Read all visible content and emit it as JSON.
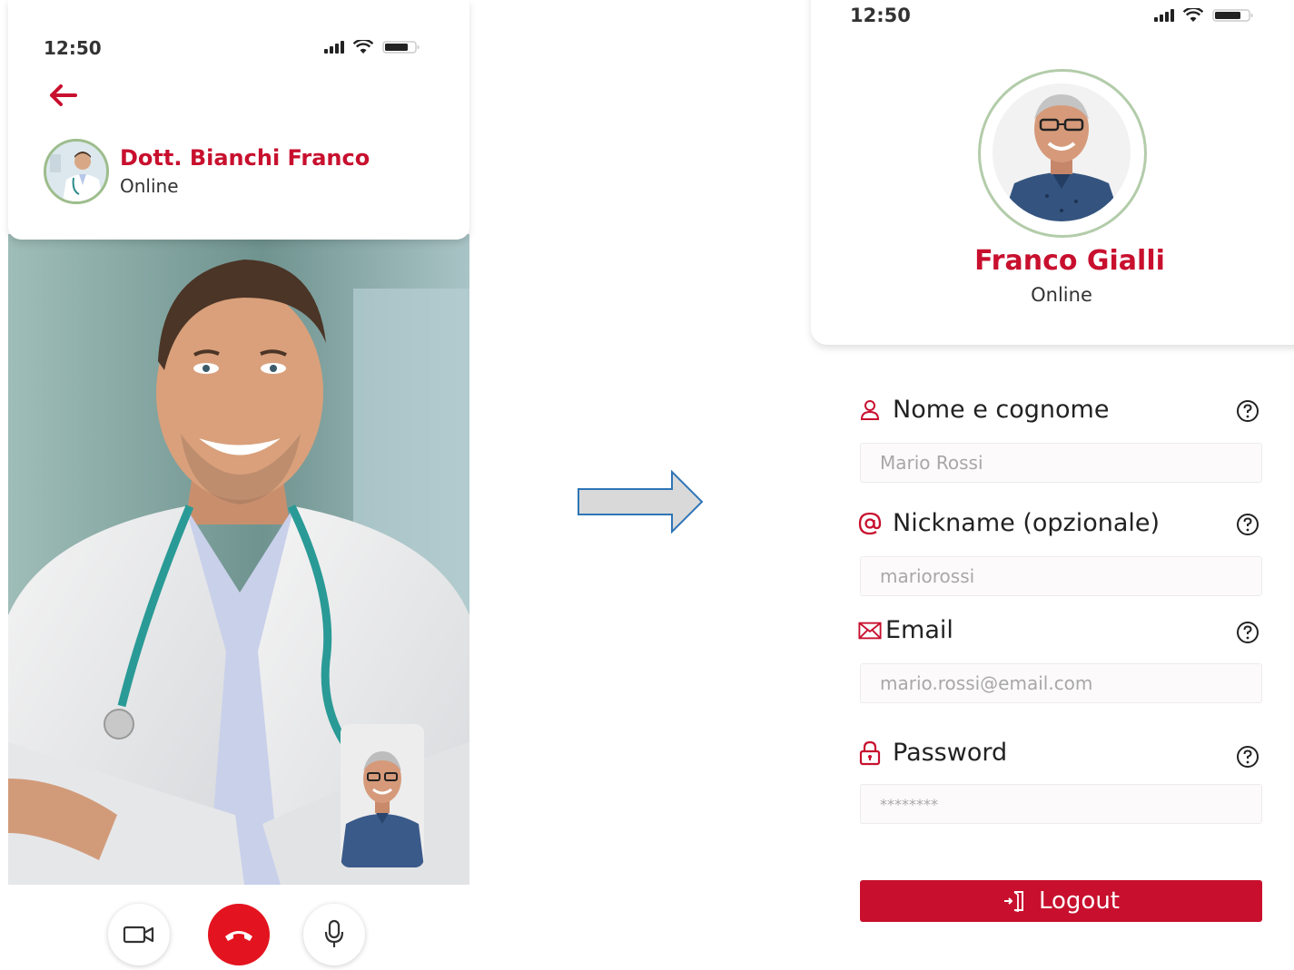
{
  "call_screen": {
    "status_time": "12:50",
    "doctor_name": "Dott. Bianchi Franco",
    "doctor_status": "Online"
  },
  "profile_screen": {
    "status_time": "12:50",
    "user_name": "Franco Gialli",
    "user_status": "Online",
    "fields": [
      {
        "label": "Nome e cognome",
        "placeholder": "Mario Rossi",
        "icon": "user-icon"
      },
      {
        "label": "Nickname (opzionale)",
        "placeholder": "mariorossi",
        "icon": "at-icon"
      },
      {
        "label": "Email",
        "placeholder": "mario.rossi@email.com",
        "icon": "mail-icon"
      },
      {
        "label": "Password",
        "placeholder": "********",
        "icon": "lock-icon"
      }
    ],
    "logout_label": "Logout"
  },
  "colors": {
    "brand_red": "#c8102e",
    "end_call_red": "#e3141f",
    "avatar_ring_green": "#9dbd8c",
    "arrow_fill": "#d9d9d9",
    "arrow_stroke": "#2e75b6"
  }
}
